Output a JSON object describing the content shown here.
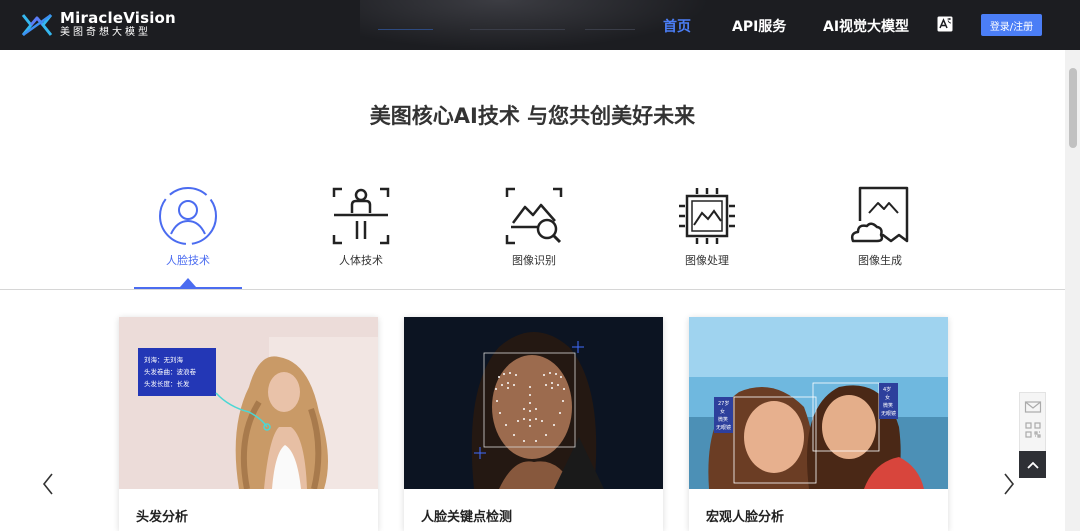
{
  "header": {
    "brand_name": "MiracleVision",
    "brand_sub": "美图奇想大模型",
    "nav": [
      {
        "label": "首页",
        "active": true
      },
      {
        "label": "API服务",
        "active": false
      },
      {
        "label": "AI视觉大模型",
        "active": false
      }
    ],
    "lang_icon": "translate-icon",
    "login_label": "登录/注册"
  },
  "main": {
    "title": "美图核心AI技术 与您共创美好未来"
  },
  "tabs": [
    {
      "label": "人脸技术",
      "icon": "face-icon",
      "active": true
    },
    {
      "label": "人体技术",
      "icon": "body-icon",
      "active": false
    },
    {
      "label": "图像识别",
      "icon": "image-search-icon",
      "active": false
    },
    {
      "label": "图像处理",
      "icon": "image-chip-icon",
      "active": false
    },
    {
      "label": "图像生成",
      "icon": "image-cloud-icon",
      "active": false
    }
  ],
  "cards": [
    {
      "title": "头发分析",
      "annotation": [
        "刘海：无刘海",
        "头发卷曲：波浪卷",
        "头发长度：长发"
      ]
    },
    {
      "title": "人脸关键点检测"
    },
    {
      "title": "宏观人脸分析",
      "left_tag": [
        "27岁",
        "女",
        "微笑",
        "无眼镜"
      ],
      "right_tag": [
        "4岁",
        "女",
        "微笑",
        "无眼镜"
      ]
    }
  ],
  "colors": {
    "accent": "#4b7ef6",
    "header_bg": "#1c1d21",
    "tab_active": "#4b6cf0"
  }
}
